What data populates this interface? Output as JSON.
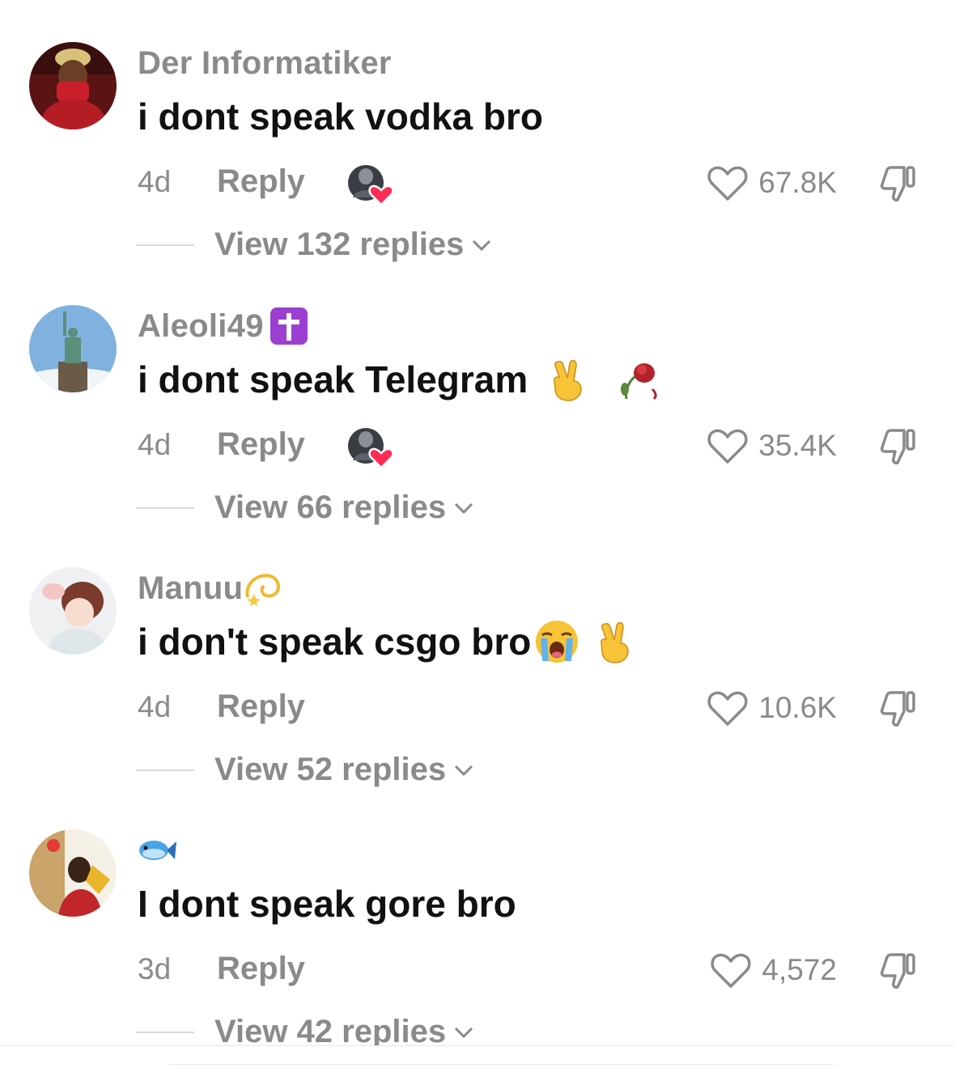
{
  "comments": [
    {
      "username": "Der Informatiker",
      "username_emoji": "",
      "text": "i dont speak vodka bro",
      "text_emojis": [],
      "age": "4d",
      "reply_label": "Reply",
      "creator_liked": true,
      "likes": "67.8K",
      "replies_label": "View 132 replies"
    },
    {
      "username": "Aleoli49",
      "username_emoji": "latin-cross-emoji",
      "text": "i dont speak Telegram",
      "text_emojis": [
        "victory-hand-emoji",
        "wilted-rose-emoji"
      ],
      "age": "4d",
      "reply_label": "Reply",
      "creator_liked": true,
      "likes": "35.4K",
      "replies_label": "View 66 replies"
    },
    {
      "username": "Manuu",
      "username_emoji": "dizzy-emoji",
      "text": "i don't speak csgo bro",
      "text_emojis": [
        "loudly-crying-face-emoji",
        "victory-hand-emoji"
      ],
      "age": "4d",
      "reply_label": "Reply",
      "creator_liked": false,
      "likes": "10.6K",
      "replies_label": "View 52 replies"
    },
    {
      "username": "",
      "username_emoji": "fish-emoji",
      "text": "I dont speak gore bro",
      "text_emojis": [],
      "age": "3d",
      "reply_label": "Reply",
      "creator_liked": false,
      "likes": "4,572",
      "replies_label": "View 42 replies"
    }
  ],
  "colors": {
    "text_primary": "#111111",
    "text_secondary": "#8a8a8a",
    "creator_heart": "#fe2c55",
    "divider": "#d8d8d8"
  }
}
